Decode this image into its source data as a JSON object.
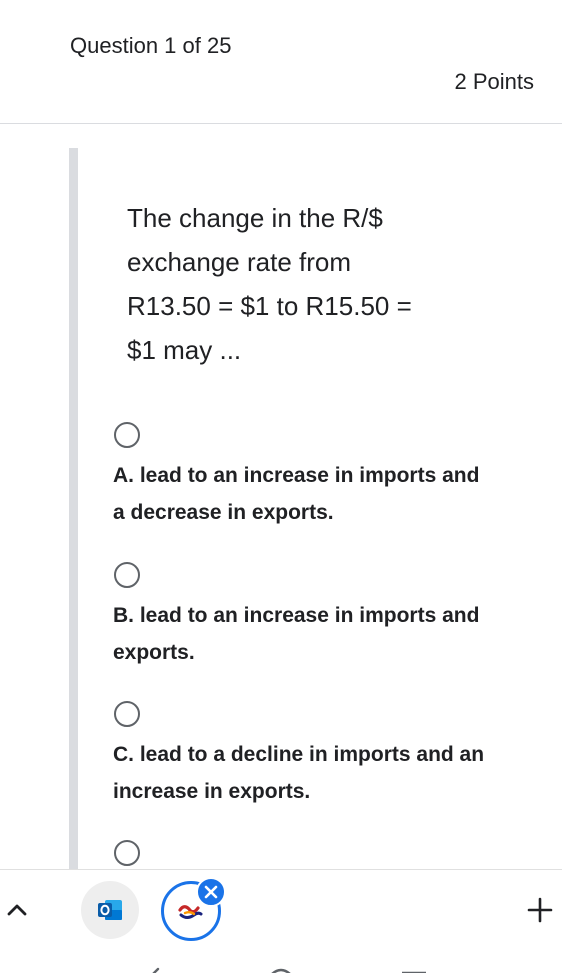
{
  "header": {
    "question_counter": "Question 1 of 25",
    "points": "2 Points"
  },
  "question": {
    "text": "The change in the R/$ exchange rate from R13.50 = $1 to R15.50 = $1 may ..."
  },
  "options": [
    {
      "label": "A. lead to an increase in imports and a decrease in exports.",
      "selected": false
    },
    {
      "label": "B. lead to an increase in imports and exports.",
      "selected": false
    },
    {
      "label": "C. lead to a decline in imports and an increase in exports.",
      "selected": false
    },
    {
      "label": "",
      "selected": false
    }
  ],
  "taskbar": {
    "icons": [
      "chevron-up-icon",
      "outlook-app-icon",
      "active-app-icon",
      "close-icon",
      "plus-icon"
    ],
    "accent_color": "#1a73e8"
  },
  "navigation": {
    "icons": [
      "back-nav-icon",
      "home-nav-icon",
      "recents-nav-icon"
    ]
  }
}
